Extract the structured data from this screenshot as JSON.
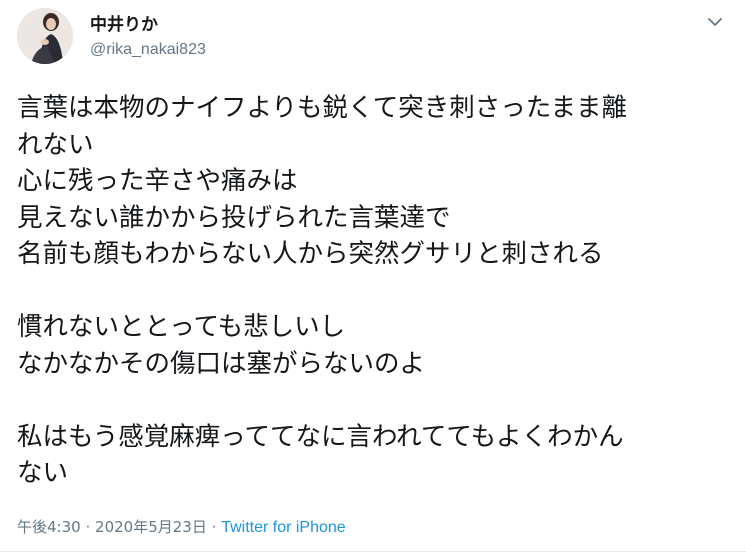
{
  "user": {
    "display_name": "中井りか",
    "handle": "@rika_nakai823"
  },
  "icons": {
    "avatar": "avatar-photo",
    "menu": "chevron-down-icon"
  },
  "tweet": {
    "lines": [
      "言葉は本物のナイフよりも鋭くて突き刺さったまま離",
      "れない",
      "心に残った辛さや痛みは",
      "見えない誰かから投げられた言葉達で",
      "名前も顔もわからない人から突然グサリと刺される",
      "",
      "慣れないととっても悲しいし",
      "なかなかその傷口は塞がらないのよ",
      "",
      "私はもう感覚麻痺っててなに言われててもよくわかん",
      "ない"
    ]
  },
  "meta": {
    "time": "午後4:30",
    "separator": "·",
    "date": "2020年5月23日",
    "source": "Twitter for iPhone"
  },
  "colors": {
    "text": "#14171a",
    "secondary": "#657786",
    "link": "#1b95e0"
  }
}
